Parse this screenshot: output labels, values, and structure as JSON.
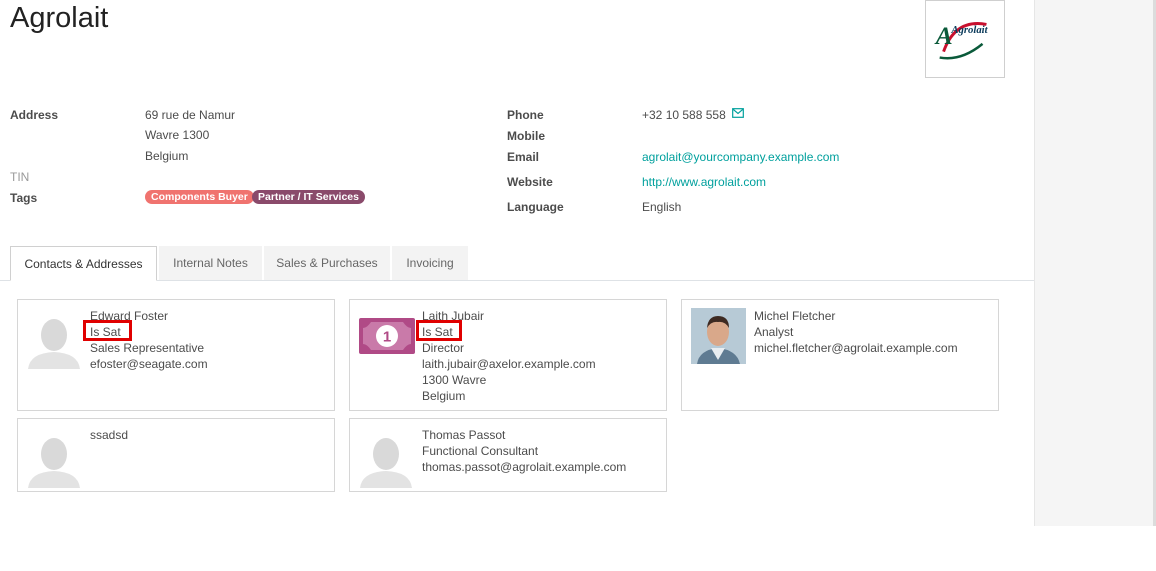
{
  "record": {
    "title": "Agrolait",
    "logo_text": "Agrolait"
  },
  "address": {
    "label": "Address",
    "street": "69 rue de Namur",
    "city_zip": "Wavre  1300",
    "country": "Belgium"
  },
  "tin": {
    "label": "TIN"
  },
  "tags": {
    "label": "Tags",
    "items": [
      {
        "label": "Components Buyer",
        "color": "#f0736f"
      },
      {
        "label": "Partner / IT Services",
        "color": "#8a4a6b"
      }
    ]
  },
  "contact_info": {
    "phone_label": "Phone",
    "phone": "+32 10 588 558",
    "mobile_label": "Mobile",
    "email_label": "Email",
    "email": "agrolait@yourcompany.example.com",
    "website_label": "Website",
    "website": "http://www.agrolait.com",
    "language_label": "Language",
    "language": "English"
  },
  "tabs": [
    {
      "label": "Contacts & Addresses",
      "active": true
    },
    {
      "label": "Internal Notes"
    },
    {
      "label": "Sales & Purchases"
    },
    {
      "label": "Invoicing"
    }
  ],
  "contacts": [
    {
      "name": "Edward Foster",
      "lines": [
        "Is Sat",
        "Sales Representative",
        "efoster@seagate.com"
      ],
      "avatar": "default-avatar-icon"
    },
    {
      "name": "Laith Jubair",
      "lines": [
        "Is Sat",
        "Director",
        "laith.jubair@axelor.example.com",
        "1300 Wavre",
        "Belgium"
      ],
      "avatar": "banknote-icon"
    },
    {
      "name": "Michel Fletcher",
      "lines": [
        "Analyst",
        "michel.fletcher@agrolait.example.com"
      ],
      "avatar": "photo"
    },
    {
      "name": "ssadsd",
      "lines": [],
      "avatar": "default-avatar-icon"
    },
    {
      "name": "Thomas Passot",
      "lines": [
        "Functional Consultant",
        "thomas.passot@agrolait.example.com"
      ],
      "avatar": "default-avatar-icon"
    }
  ],
  "colors": {
    "link": "#00a09d",
    "highlight": "#e00000",
    "tag_pink": "#f0736f",
    "tag_plum": "#8a4a6b",
    "banknote": "#b04a86"
  }
}
